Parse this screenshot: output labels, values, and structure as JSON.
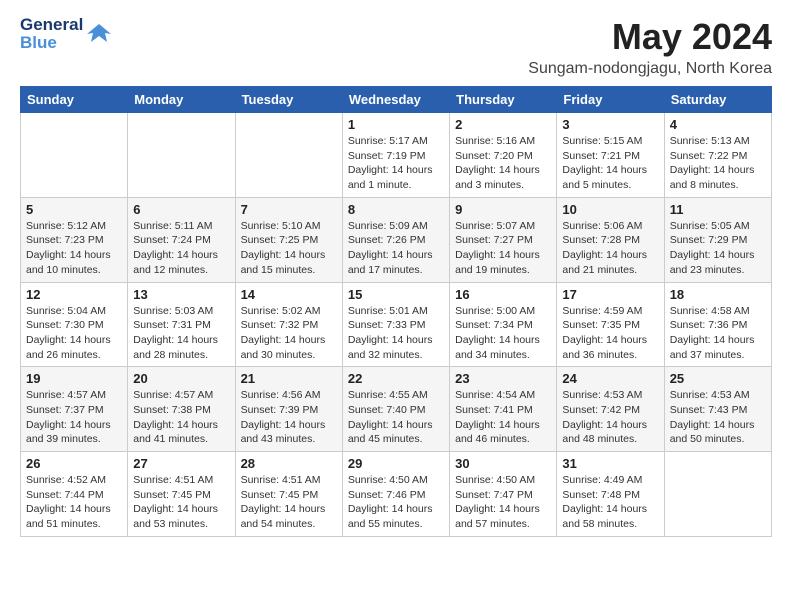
{
  "logo": {
    "general": "General",
    "blue": "Blue"
  },
  "title": {
    "month_year": "May 2024",
    "location": "Sungam-nodongjagu, North Korea"
  },
  "weekdays": [
    "Sunday",
    "Monday",
    "Tuesday",
    "Wednesday",
    "Thursday",
    "Friday",
    "Saturday"
  ],
  "weeks": [
    [
      {
        "day": "",
        "sunrise": "",
        "sunset": "",
        "daylight": ""
      },
      {
        "day": "",
        "sunrise": "",
        "sunset": "",
        "daylight": ""
      },
      {
        "day": "",
        "sunrise": "",
        "sunset": "",
        "daylight": ""
      },
      {
        "day": "1",
        "sunrise": "Sunrise: 5:17 AM",
        "sunset": "Sunset: 7:19 PM",
        "daylight": "Daylight: 14 hours and 1 minute."
      },
      {
        "day": "2",
        "sunrise": "Sunrise: 5:16 AM",
        "sunset": "Sunset: 7:20 PM",
        "daylight": "Daylight: 14 hours and 3 minutes."
      },
      {
        "day": "3",
        "sunrise": "Sunrise: 5:15 AM",
        "sunset": "Sunset: 7:21 PM",
        "daylight": "Daylight: 14 hours and 5 minutes."
      },
      {
        "day": "4",
        "sunrise": "Sunrise: 5:13 AM",
        "sunset": "Sunset: 7:22 PM",
        "daylight": "Daylight: 14 hours and 8 minutes."
      }
    ],
    [
      {
        "day": "5",
        "sunrise": "Sunrise: 5:12 AM",
        "sunset": "Sunset: 7:23 PM",
        "daylight": "Daylight: 14 hours and 10 minutes."
      },
      {
        "day": "6",
        "sunrise": "Sunrise: 5:11 AM",
        "sunset": "Sunset: 7:24 PM",
        "daylight": "Daylight: 14 hours and 12 minutes."
      },
      {
        "day": "7",
        "sunrise": "Sunrise: 5:10 AM",
        "sunset": "Sunset: 7:25 PM",
        "daylight": "Daylight: 14 hours and 15 minutes."
      },
      {
        "day": "8",
        "sunrise": "Sunrise: 5:09 AM",
        "sunset": "Sunset: 7:26 PM",
        "daylight": "Daylight: 14 hours and 17 minutes."
      },
      {
        "day": "9",
        "sunrise": "Sunrise: 5:07 AM",
        "sunset": "Sunset: 7:27 PM",
        "daylight": "Daylight: 14 hours and 19 minutes."
      },
      {
        "day": "10",
        "sunrise": "Sunrise: 5:06 AM",
        "sunset": "Sunset: 7:28 PM",
        "daylight": "Daylight: 14 hours and 21 minutes."
      },
      {
        "day": "11",
        "sunrise": "Sunrise: 5:05 AM",
        "sunset": "Sunset: 7:29 PM",
        "daylight": "Daylight: 14 hours and 23 minutes."
      }
    ],
    [
      {
        "day": "12",
        "sunrise": "Sunrise: 5:04 AM",
        "sunset": "Sunset: 7:30 PM",
        "daylight": "Daylight: 14 hours and 26 minutes."
      },
      {
        "day": "13",
        "sunrise": "Sunrise: 5:03 AM",
        "sunset": "Sunset: 7:31 PM",
        "daylight": "Daylight: 14 hours and 28 minutes."
      },
      {
        "day": "14",
        "sunrise": "Sunrise: 5:02 AM",
        "sunset": "Sunset: 7:32 PM",
        "daylight": "Daylight: 14 hours and 30 minutes."
      },
      {
        "day": "15",
        "sunrise": "Sunrise: 5:01 AM",
        "sunset": "Sunset: 7:33 PM",
        "daylight": "Daylight: 14 hours and 32 minutes."
      },
      {
        "day": "16",
        "sunrise": "Sunrise: 5:00 AM",
        "sunset": "Sunset: 7:34 PM",
        "daylight": "Daylight: 14 hours and 34 minutes."
      },
      {
        "day": "17",
        "sunrise": "Sunrise: 4:59 AM",
        "sunset": "Sunset: 7:35 PM",
        "daylight": "Daylight: 14 hours and 36 minutes."
      },
      {
        "day": "18",
        "sunrise": "Sunrise: 4:58 AM",
        "sunset": "Sunset: 7:36 PM",
        "daylight": "Daylight: 14 hours and 37 minutes."
      }
    ],
    [
      {
        "day": "19",
        "sunrise": "Sunrise: 4:57 AM",
        "sunset": "Sunset: 7:37 PM",
        "daylight": "Daylight: 14 hours and 39 minutes."
      },
      {
        "day": "20",
        "sunrise": "Sunrise: 4:57 AM",
        "sunset": "Sunset: 7:38 PM",
        "daylight": "Daylight: 14 hours and 41 minutes."
      },
      {
        "day": "21",
        "sunrise": "Sunrise: 4:56 AM",
        "sunset": "Sunset: 7:39 PM",
        "daylight": "Daylight: 14 hours and 43 minutes."
      },
      {
        "day": "22",
        "sunrise": "Sunrise: 4:55 AM",
        "sunset": "Sunset: 7:40 PM",
        "daylight": "Daylight: 14 hours and 45 minutes."
      },
      {
        "day": "23",
        "sunrise": "Sunrise: 4:54 AM",
        "sunset": "Sunset: 7:41 PM",
        "daylight": "Daylight: 14 hours and 46 minutes."
      },
      {
        "day": "24",
        "sunrise": "Sunrise: 4:53 AM",
        "sunset": "Sunset: 7:42 PM",
        "daylight": "Daylight: 14 hours and 48 minutes."
      },
      {
        "day": "25",
        "sunrise": "Sunrise: 4:53 AM",
        "sunset": "Sunset: 7:43 PM",
        "daylight": "Daylight: 14 hours and 50 minutes."
      }
    ],
    [
      {
        "day": "26",
        "sunrise": "Sunrise: 4:52 AM",
        "sunset": "Sunset: 7:44 PM",
        "daylight": "Daylight: 14 hours and 51 minutes."
      },
      {
        "day": "27",
        "sunrise": "Sunrise: 4:51 AM",
        "sunset": "Sunset: 7:45 PM",
        "daylight": "Daylight: 14 hours and 53 minutes."
      },
      {
        "day": "28",
        "sunrise": "Sunrise: 4:51 AM",
        "sunset": "Sunset: 7:45 PM",
        "daylight": "Daylight: 14 hours and 54 minutes."
      },
      {
        "day": "29",
        "sunrise": "Sunrise: 4:50 AM",
        "sunset": "Sunset: 7:46 PM",
        "daylight": "Daylight: 14 hours and 55 minutes."
      },
      {
        "day": "30",
        "sunrise": "Sunrise: 4:50 AM",
        "sunset": "Sunset: 7:47 PM",
        "daylight": "Daylight: 14 hours and 57 minutes."
      },
      {
        "day": "31",
        "sunrise": "Sunrise: 4:49 AM",
        "sunset": "Sunset: 7:48 PM",
        "daylight": "Daylight: 14 hours and 58 minutes."
      },
      {
        "day": "",
        "sunrise": "",
        "sunset": "",
        "daylight": ""
      }
    ]
  ]
}
